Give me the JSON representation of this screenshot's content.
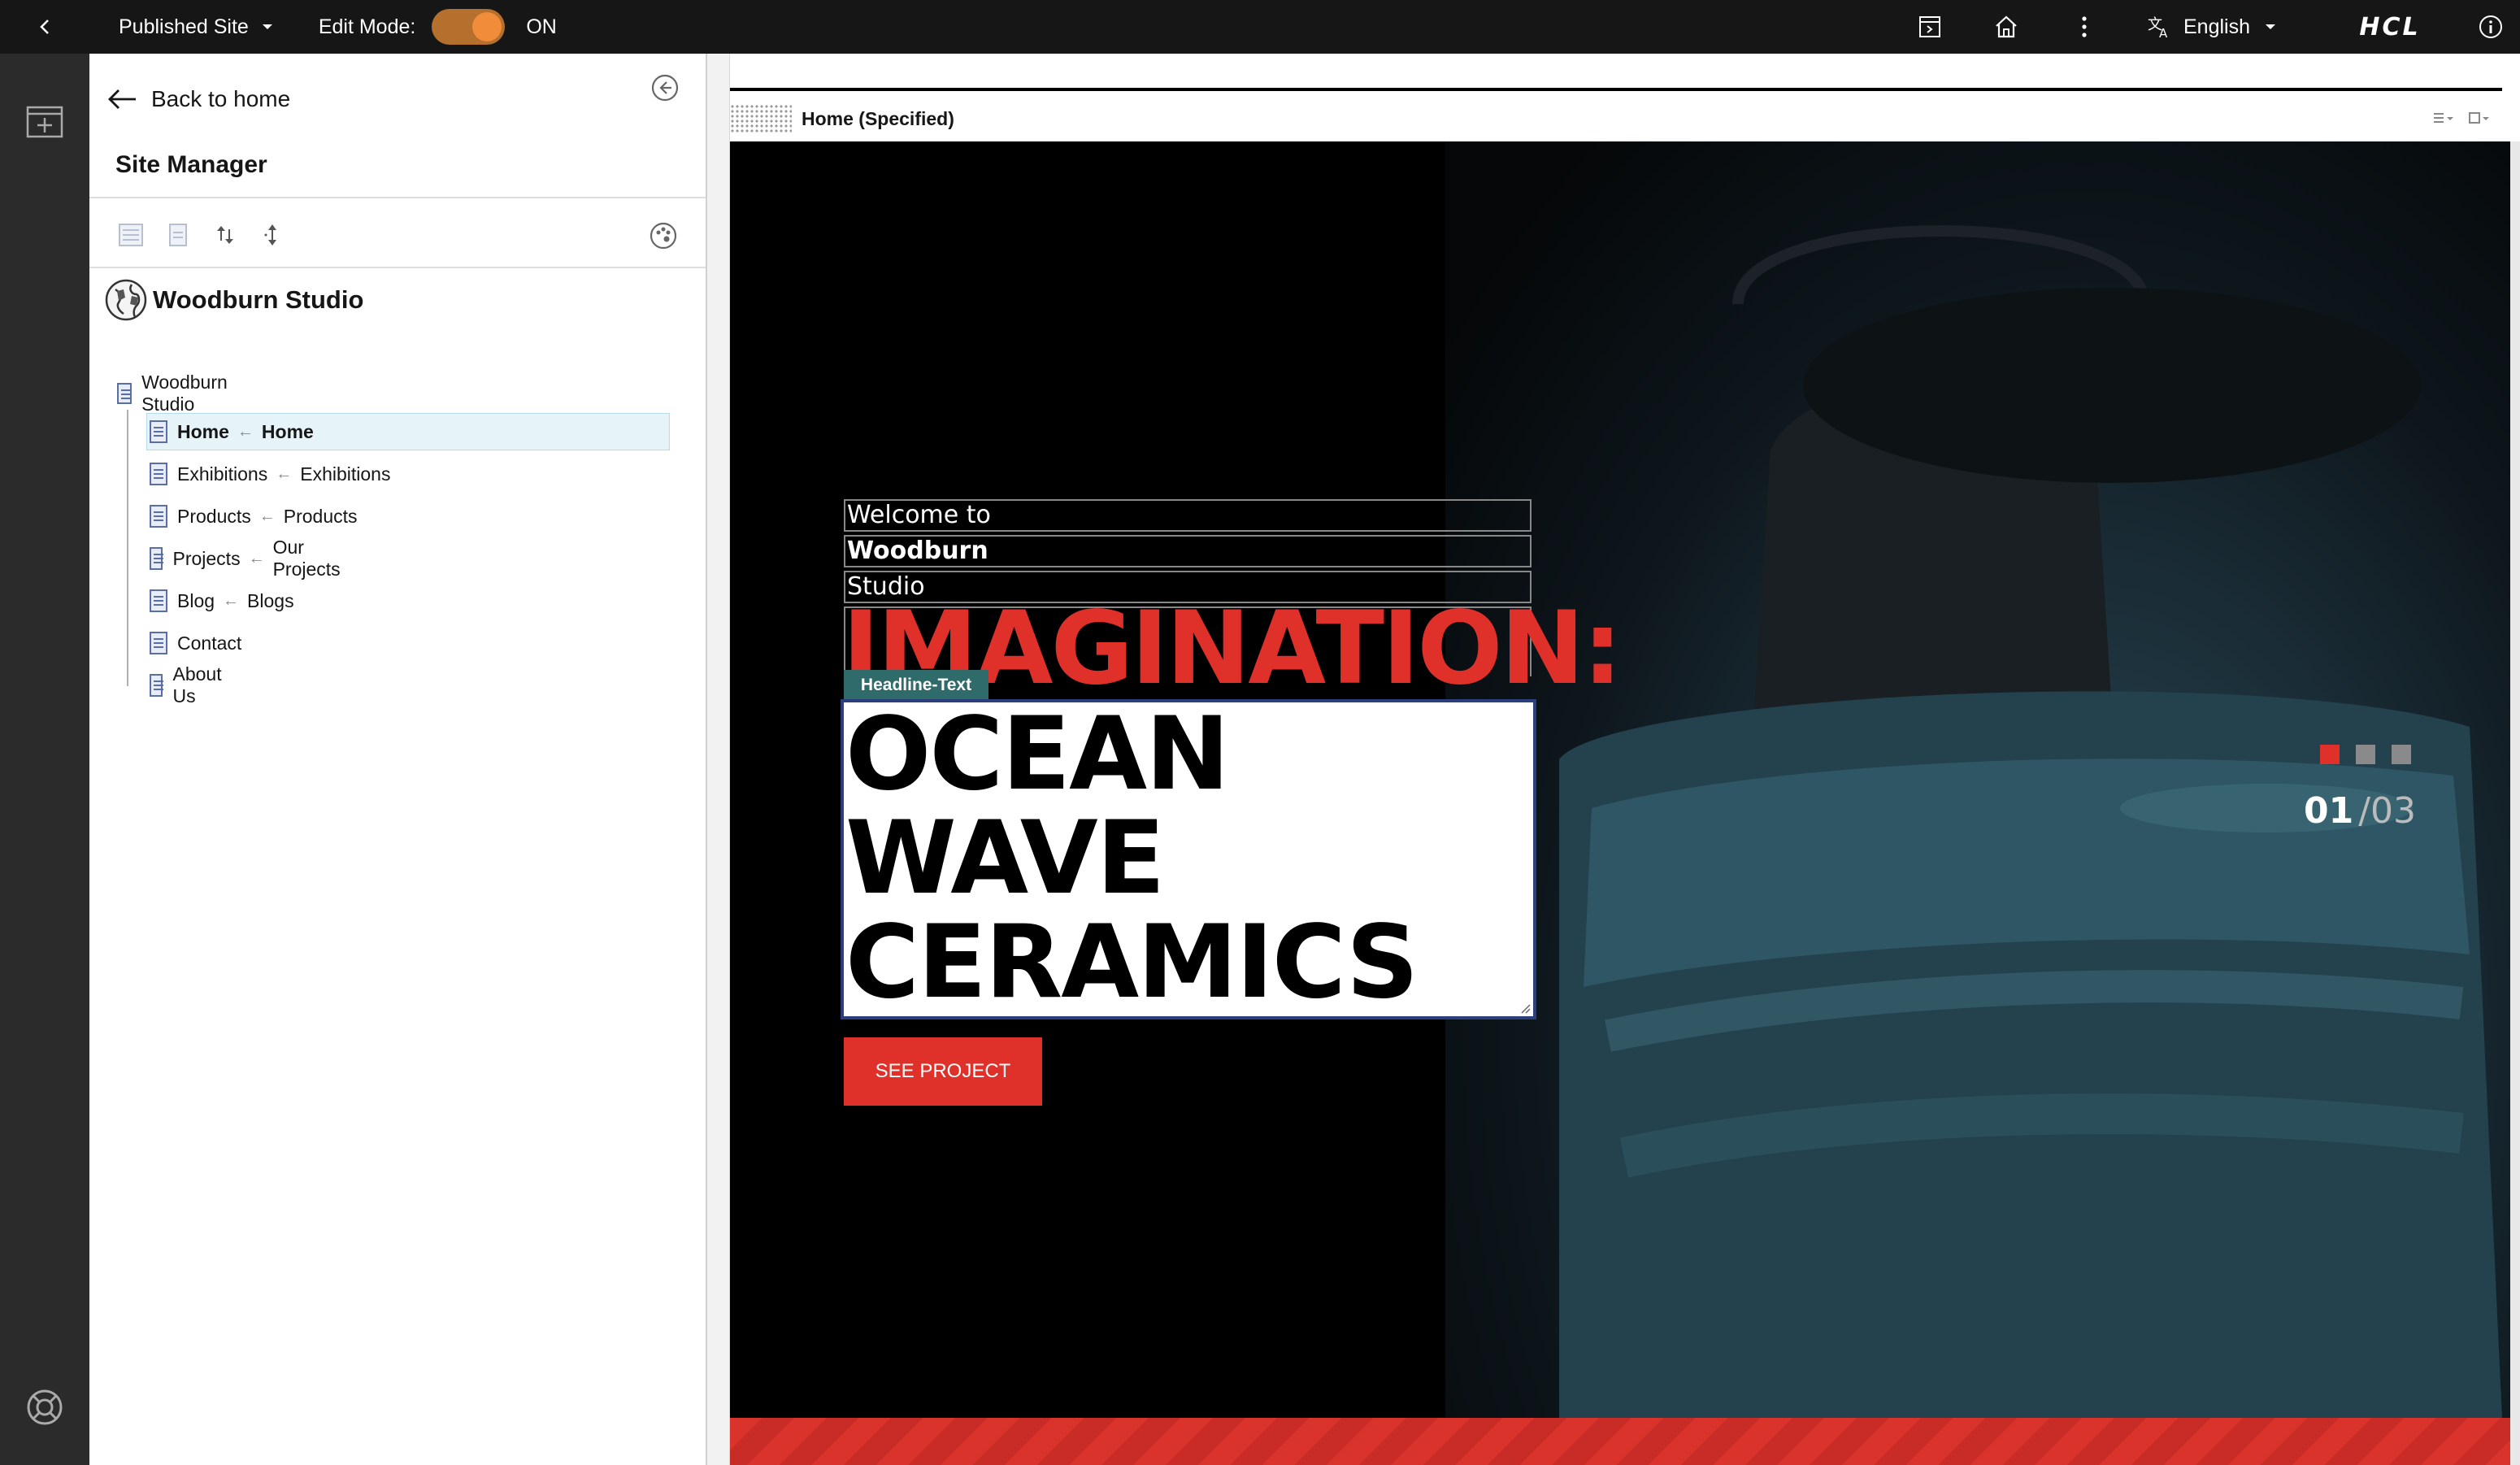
{
  "topbar": {
    "published_site": "Published Site",
    "edit_mode_label": "Edit Mode:",
    "edit_mode_state": "ON",
    "language": "English",
    "brand": "HCL"
  },
  "panel": {
    "back_label": "Back to home",
    "title": "Site Manager",
    "site_name": "Woodburn Studio",
    "tree_root": "Woodburn Studio",
    "tree": [
      {
        "label": "Home",
        "target": "Home"
      },
      {
        "label": "Exhibitions",
        "target": "Exhibitions"
      },
      {
        "label": "Products",
        "target": "Products"
      },
      {
        "label": "Projects",
        "target": "Our Projects"
      },
      {
        "label": "Blog",
        "target": "Blogs"
      },
      {
        "label": "Contact",
        "target": ""
      },
      {
        "label": "About Us",
        "target": ""
      }
    ]
  },
  "canvas": {
    "page_title": "Home (Specified)",
    "hero": {
      "welcome": "Welcome to",
      "brand_line": "Woodburn",
      "studio_line": "Studio",
      "imagination": "IMAGINATION:",
      "tag": "Headline-Text",
      "headline_1": "OCEAN",
      "headline_2": "WAVE",
      "headline_3": "CERAMICS",
      "cta": "SEE PROJECT",
      "counter_current": "01",
      "counter_total": "/03"
    }
  },
  "colors": {
    "accent_red": "#e0302a",
    "toggle_on": "#f08c3a",
    "tag_bg": "#2f6b6b"
  }
}
